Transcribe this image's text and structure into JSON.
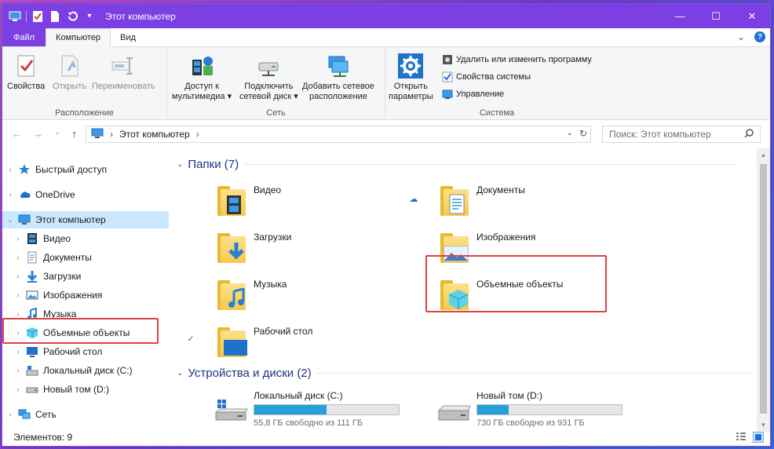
{
  "window": {
    "title": "Этот компьютер",
    "controls": {
      "minimize": "—",
      "maximize": "☐",
      "close": "✕"
    }
  },
  "quick_access_toolbar": {
    "icons": [
      "computer-icon",
      "properties-check-icon",
      "new-folder-icon",
      "undo-icon"
    ],
    "dropdown": "▾"
  },
  "ribbon": {
    "tabs": [
      {
        "label": "Файл",
        "type": "file"
      },
      {
        "label": "Компьютер",
        "active": true
      },
      {
        "label": "Вид"
      }
    ],
    "collapse_chevron": "⌄",
    "help": "?",
    "groups": {
      "location": {
        "label": "Расположение",
        "buttons": {
          "properties": "Свойства",
          "open": "Открыть",
          "rename": "Переименовать"
        }
      },
      "network": {
        "label": "Сеть",
        "buttons": {
          "media_access_1": "Доступ к",
          "media_access_2": "мультимедиа ▾",
          "map_drive_1": "Подключить",
          "map_drive_2": "сетевой диск ▾",
          "add_location_1": "Добавить сетевое",
          "add_location_2": "расположение"
        }
      },
      "system": {
        "label": "Система",
        "open_settings_1": "Открыть",
        "open_settings_2": "параметры",
        "uninstall": "Удалить или изменить программу",
        "system_properties": "Свойства системы",
        "manage": "Управление"
      }
    }
  },
  "address_bar": {
    "nav": {
      "back": "←",
      "forward": "→",
      "recent": "⌄",
      "up": "↑"
    },
    "path_sep": "›",
    "path": "Этот компьютер",
    "path_end": "›",
    "dropdown": "⌄",
    "refresh": "↻",
    "search_placeholder": "Поиск: Этот компьютер"
  },
  "nav_pane": {
    "quick_access": "Быстрый доступ",
    "onedrive": "OneDrive",
    "this_pc": "Этот компьютер",
    "videos": "Видео",
    "documents": "Документы",
    "downloads": "Загрузки",
    "pictures": "Изображения",
    "music": "Музыка",
    "objects3d": "Объемные объекты",
    "desktop": "Рабочий стол",
    "local_disk": "Локальный диск (C:)",
    "new_volume": "Новый том (D:)",
    "network": "Сеть",
    "chev_right": "›",
    "chev_down": "⌄"
  },
  "content": {
    "folders_header": "Папки (7)",
    "devices_header": "Устройства и диски (2)",
    "folders": {
      "videos": "Видео",
      "documents": "Документы",
      "downloads": "Загрузки",
      "pictures": "Изображения",
      "music": "Музыка",
      "objects3d": "Объемные объекты",
      "desktop": "Рабочий стол"
    },
    "status_icons": {
      "documents": "☁",
      "desktop": "✓"
    },
    "drives": [
      {
        "name": "Локальный диск (C:)",
        "free_text": "55,8 ГБ свободно из 111 ГБ",
        "used_fraction": 0.5
      },
      {
        "name": "Новый том (D:)",
        "free_text": "730 ГБ свободно из 931 ГБ",
        "used_fraction": 0.22
      }
    ]
  },
  "statusbar": {
    "items": "Элементов: 9"
  },
  "colors": {
    "titlebar": "#7b3fe4",
    "selection": "#cce8ff",
    "accent_text": "#1e3287",
    "drive_fill": "#26a0da",
    "highlight": "#e04040"
  }
}
